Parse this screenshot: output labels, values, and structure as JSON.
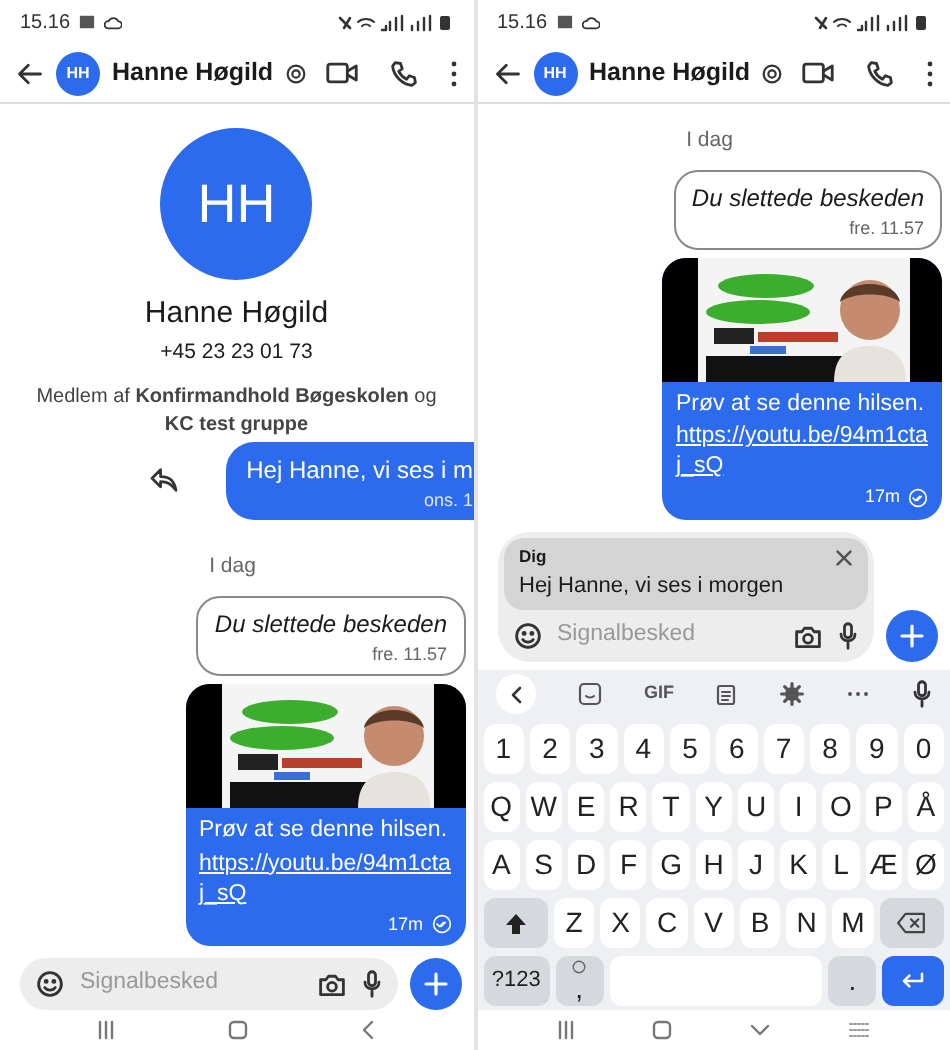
{
  "panels": [
    {
      "status_bar": {
        "time": "15.16"
      },
      "header": {
        "initials": "HH",
        "name": "Hanne Høgild"
      },
      "profile": {
        "initials": "HH",
        "name": "Hanne Høgild",
        "phone": "+45 23 23 01 73",
        "membership": "Medlem af **Konfirmandhold Bøgeskolen** og **KC test gruppe**"
      },
      "messages": [
        {
          "kind": "outgoing",
          "text": "Hej Hanne, vi ses i m",
          "time": "ons. 1"
        },
        {
          "kind": "date",
          "text": "I dag"
        },
        {
          "kind": "deleted",
          "text": "Du slettede beskeden",
          "time": "fre. 11.57"
        },
        {
          "kind": "media",
          "text": "Prøv at se denne hilsen.",
          "link": "https://youtu.be/94m1ctaj_sQ",
          "time": "17m"
        }
      ],
      "composer": {
        "placeholder": "Signalbesked"
      }
    },
    {
      "status_bar": {
        "time": "15.16"
      },
      "header": {
        "initials": "HH",
        "name": "Hanne Høgild"
      },
      "messages": [
        {
          "kind": "date",
          "text": "I dag"
        },
        {
          "kind": "deleted",
          "text": "Du slettede beskeden",
          "time": "fre. 11.57"
        },
        {
          "kind": "media",
          "text": "Prøv at se denne hilsen.",
          "link": "https://youtu.be/94m1ctaj_sQ",
          "time": "17m"
        }
      ],
      "reply_preview": {
        "author": "Dig",
        "text": "Hej Hanne, vi ses i morgen"
      },
      "composer": {
        "placeholder": "Signalbesked"
      },
      "keyboard": {
        "toolbar_label": "GIF",
        "number_row": {
          "keys": [
            "1",
            "2",
            "3",
            "4",
            "5",
            "6",
            "7",
            "8",
            "9",
            "0"
          ]
        },
        "top_letter_row": {
          "keys": [
            "Q",
            "W",
            "E",
            "R",
            "T",
            "Y",
            "U",
            "I",
            "O",
            "P",
            "Å"
          ]
        },
        "middle_letter_row": {
          "keys": [
            "A",
            "S",
            "D",
            "F",
            "G",
            "H",
            "J",
            "K",
            "L",
            "Æ",
            "Ø"
          ]
        },
        "bottom_letter_row": {
          "keys": [
            "Z",
            "X",
            "C",
            "V",
            "B",
            "N",
            "M"
          ]
        },
        "function_row": {
          "mode_key": "?123",
          "comma_key": ",",
          "period_key": "."
        }
      }
    }
  ]
}
